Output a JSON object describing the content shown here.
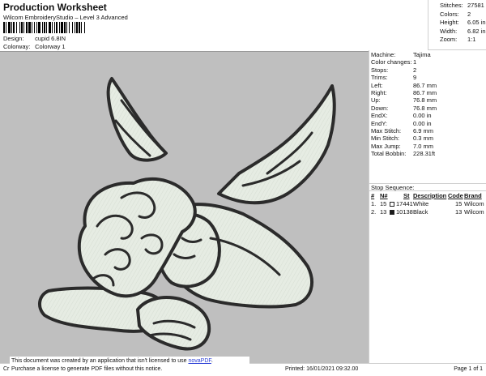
{
  "header": {
    "title": "Production Worksheet",
    "subtitle": "Wilcom EmbroideryStudio – Level 3 Advanced",
    "design_label": "Design:",
    "design_value": "cupid 6.8IN",
    "colorway_label": "Colorway:",
    "colorway_value": "Colorway 1"
  },
  "stats": [
    {
      "label": "Stitches:",
      "value": "27581"
    },
    {
      "label": "Colors:",
      "value": "2"
    },
    {
      "label": "Height:",
      "value": "6.05 in"
    },
    {
      "label": "Width:",
      "value": "6.82 in"
    },
    {
      "label": "Zoom:",
      "value": "1:1"
    }
  ],
  "machine_info": [
    {
      "label": "Machine:",
      "value": "Tajima"
    },
    {
      "label": "Color changes:",
      "value": "1"
    },
    {
      "label": "Stops:",
      "value": "2"
    },
    {
      "label": "Trims:",
      "value": "9"
    },
    {
      "label": "Left:",
      "value": "86.7 mm"
    },
    {
      "label": "Right:",
      "value": "86.7 mm"
    },
    {
      "label": "Up:",
      "value": "76.8 mm"
    },
    {
      "label": "Down:",
      "value": "76.8 mm"
    },
    {
      "label": "EndX:",
      "value": "0.00 in"
    },
    {
      "label": "EndY:",
      "value": "0.00 in"
    },
    {
      "label": "Max Stitch:",
      "value": "6.9 mm"
    },
    {
      "label": "Min Stitch:",
      "value": "0.3 mm"
    },
    {
      "label": "Max Jump:",
      "value": "7.0 mm"
    },
    {
      "label": "Total Bobbin:",
      "value": "228.31ft"
    }
  ],
  "stop_sequence": {
    "title": "Stop Sequence:",
    "headers": {
      "num": "#",
      "n": "N#",
      "st": "St",
      "description": "Description",
      "code": "Code",
      "brand": "Brand"
    },
    "rows": [
      {
        "num": "1.",
        "n": "15",
        "swatch": "#ffffff",
        "st": "17441",
        "description": "White",
        "code": "15",
        "brand": "Wilcom"
      },
      {
        "num": "2.",
        "n": "13",
        "swatch": "#1a1a1a",
        "st": "10138",
        "description": "Black",
        "code": "13",
        "brand": "Wilcom"
      }
    ]
  },
  "colors": {
    "canvas": "#bfbfbf",
    "fill": "#e6ece3",
    "outline": "#2b2b2b"
  },
  "footer": {
    "left": "Cr",
    "printed": "Printed: 16/01/2021 09:32.00",
    "page": "Page 1 of 1"
  },
  "notice": {
    "line1": "This document was created by an application that isn't licensed to use ",
    "link": "novaPDF",
    "line1_end": ".",
    "line2": "Purchase a license to generate PDF files without this notice."
  }
}
